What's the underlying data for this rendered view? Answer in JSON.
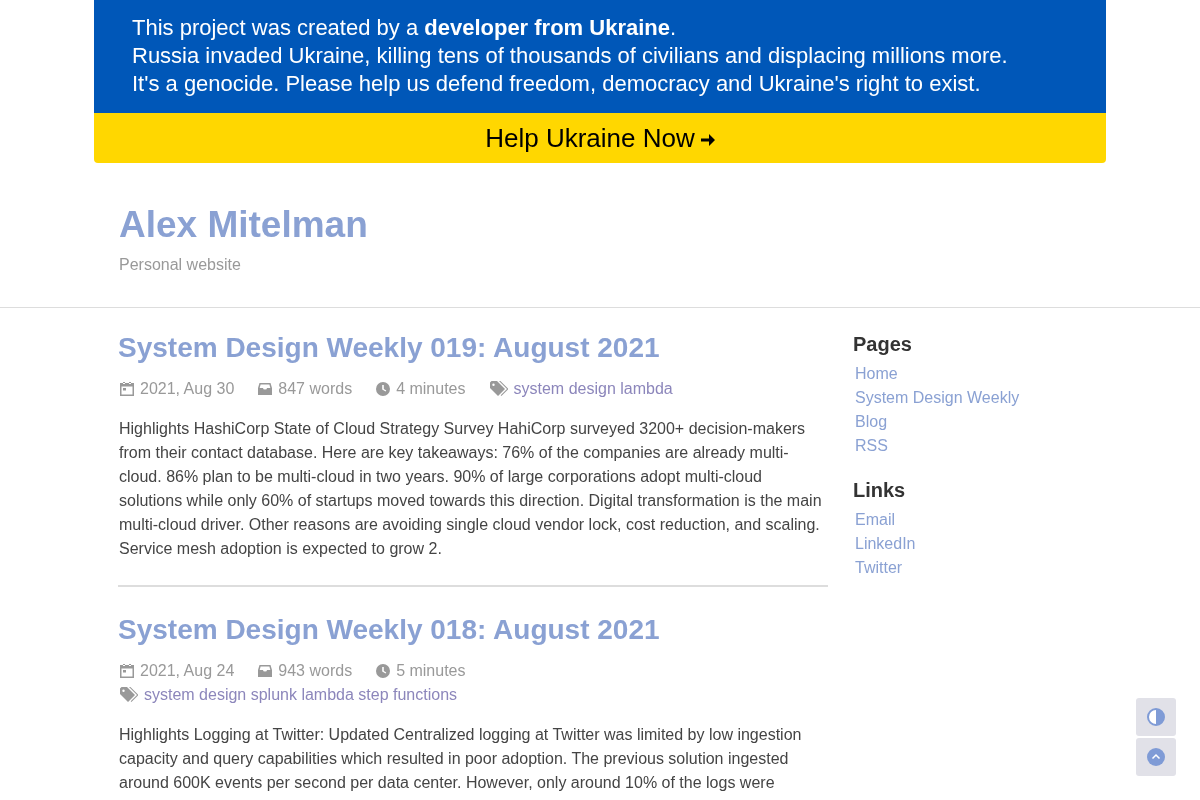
{
  "banner": {
    "message_lines": [
      "This project was created by a **developer from Ukraine**.",
      "Russia invaded Ukraine, killing tens of thousands of civilians and displacing millions more.",
      "It's a genocide. Please help us defend freedom, democracy and Ukraine's right to exist."
    ],
    "button": {
      "label": "Help Ukraine Now"
    }
  },
  "site": {
    "title": "Alex Mitelman",
    "subtitle": "Personal website"
  },
  "posts": [
    {
      "title": "System Design Weekly 019: August 2021",
      "date": "2021, Aug 30",
      "words": "847 words",
      "reading_time": "4 minutes",
      "tags": "system design lambda",
      "summary": "Highlights HashiCorp State of Cloud Strategy Survey HahiCorp surveyed 3200+ decision-makers from their contact database. Here are key takeaways: 76% of the companies are already multi-cloud. 86% plan to be multi-cloud in two years. 90% of large corporations adopt multi-cloud solutions while only 60% of startups moved towards this direction. Digital transformation is the main multi-cloud driver. Other reasons are avoiding single cloud vendor lock, cost reduction, and scaling. Service mesh adoption is expected to grow 2."
    },
    {
      "title": "System Design Weekly 018: August 2021",
      "date": "2021, Aug 24",
      "words": "943 words",
      "reading_time": "5 minutes",
      "tags": "system design splunk lambda step functions",
      "summary": "Highlights Logging at Twitter: Updated Centralized logging at Twitter was limited by low ingestion capacity and query capabilities which resulted in poor adoption. The previous solution ingested around 600K events per second per data center. However, only around 10% of the logs were"
    }
  ],
  "sidebar": {
    "sections": [
      {
        "heading": "Pages",
        "links": [
          "Home",
          "System Design Weekly",
          "Blog",
          "RSS"
        ]
      },
      {
        "heading": "Links",
        "links": [
          "Email",
          "LinkedIn",
          "Twitter"
        ]
      }
    ]
  },
  "floating_buttons": [
    {
      "kind": "theme"
    },
    {
      "kind": "scroll_top"
    }
  ]
}
